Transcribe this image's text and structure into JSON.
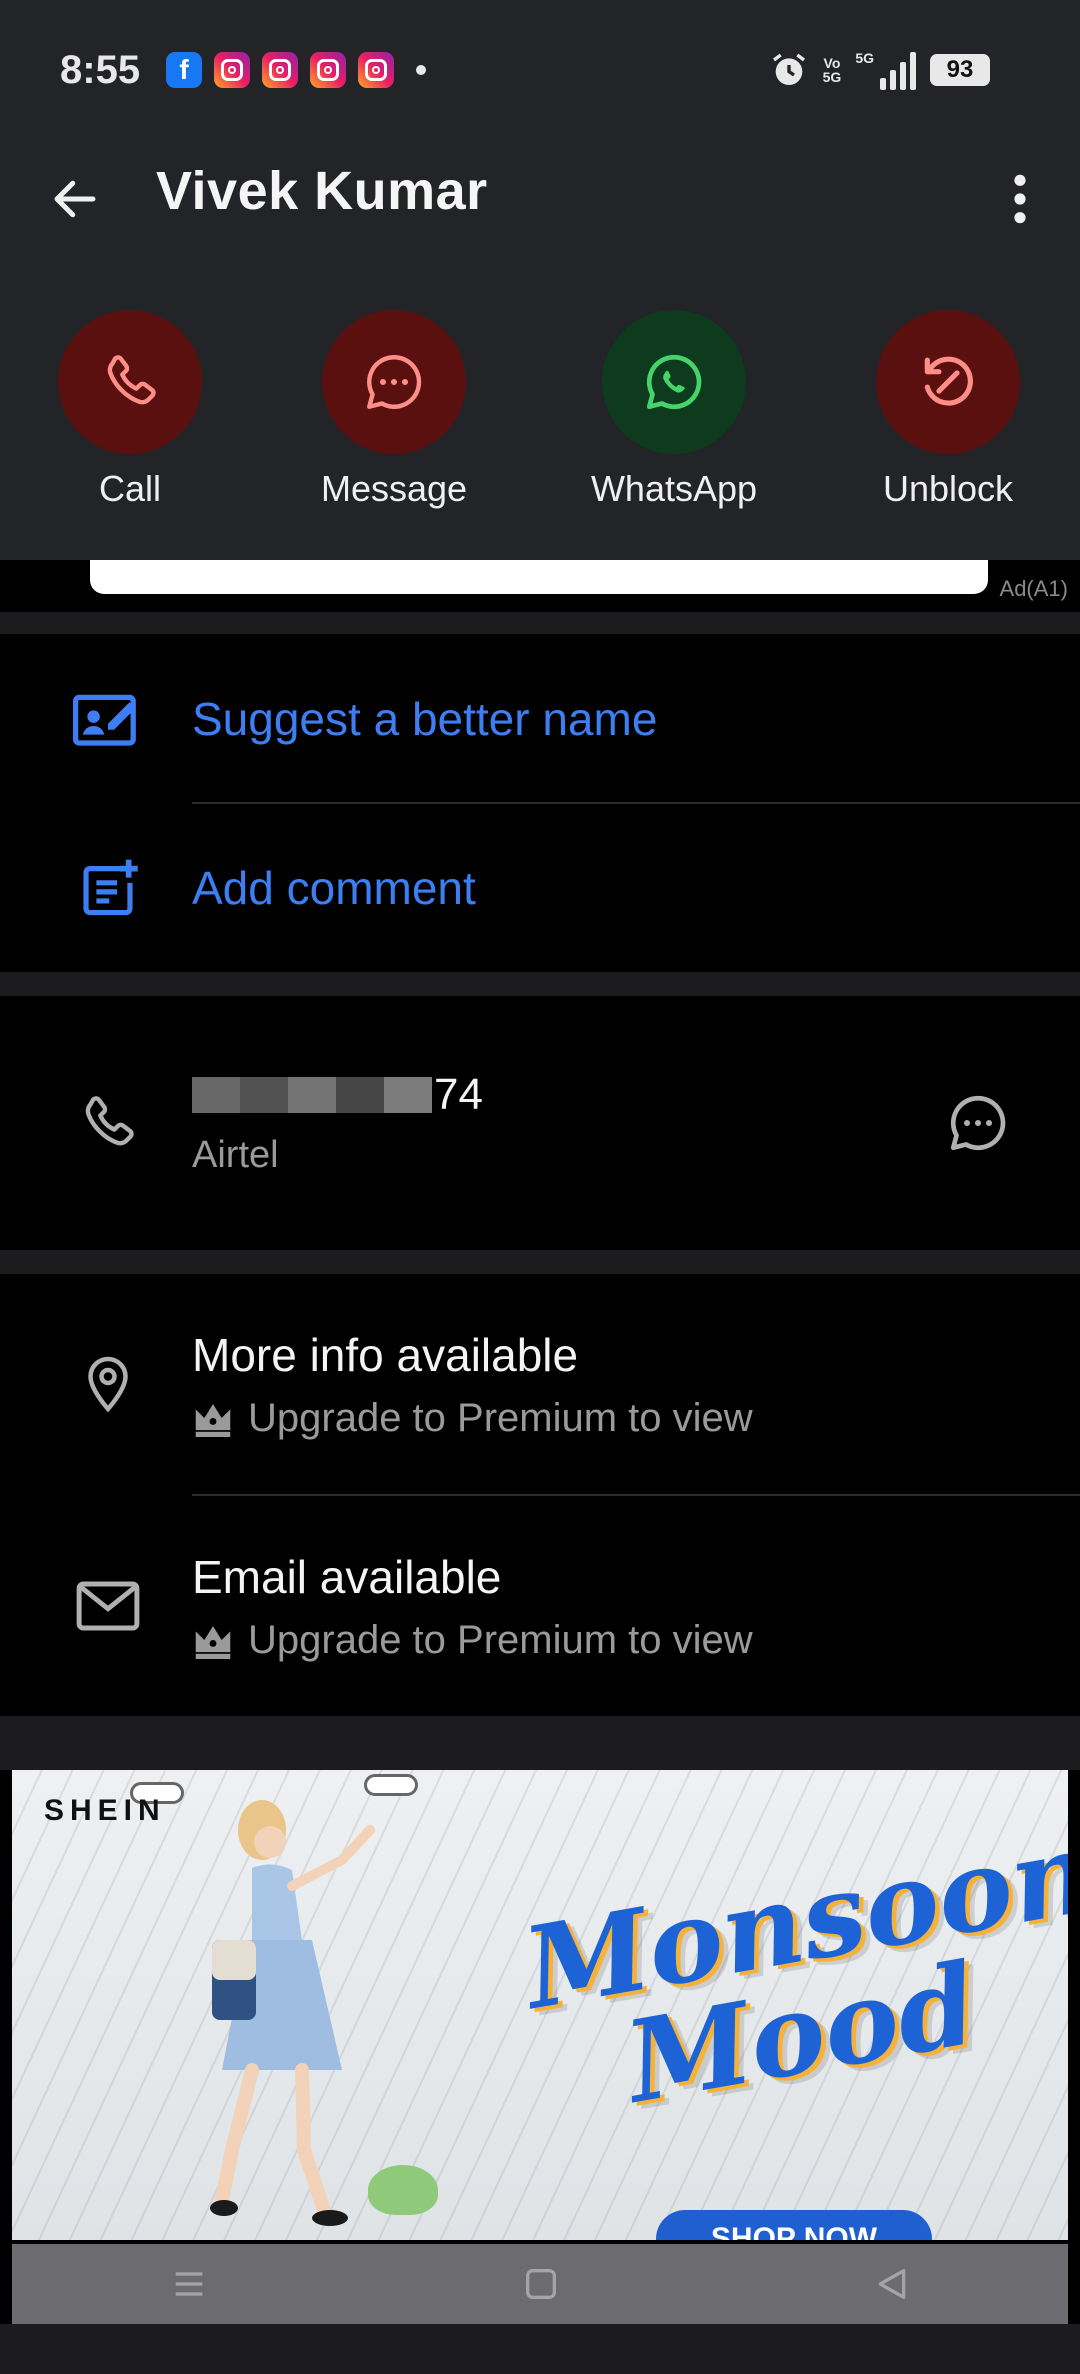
{
  "status_bar": {
    "time": "8:55",
    "notifications": [
      "facebook-icon",
      "instagram-icon",
      "instagram-icon",
      "instagram-icon",
      "instagram-icon"
    ],
    "volte_top": "Vo",
    "volte_bottom": "5G",
    "network": "5G",
    "battery": "93"
  },
  "header": {
    "title": "Vivek Kumar"
  },
  "actions": [
    {
      "label": "Call",
      "icon": "phone-icon",
      "color": "#5a100f"
    },
    {
      "label": "Message",
      "icon": "chat-icon",
      "color": "#5a100f"
    },
    {
      "label": "WhatsApp",
      "icon": "whatsapp-icon",
      "color": "#0e3a1d"
    },
    {
      "label": "Unblock",
      "icon": "unblock-icon",
      "color": "#5a100f"
    }
  ],
  "ad_strip": {
    "tag": "Ad(A1)"
  },
  "suggest": {
    "suggest_name": "Suggest a better name",
    "add_comment": "Add comment"
  },
  "phone": {
    "number_suffix": "74",
    "carrier": "Airtel"
  },
  "more_info": {
    "title": "More info available",
    "subtitle": "Upgrade to Premium to view"
  },
  "email": {
    "title": "Email available",
    "subtitle": "Upgrade to Premium to view"
  },
  "banner": {
    "brand": "SHEIN",
    "headline": "Monsoon Mood",
    "cta": "SHOP NOW"
  },
  "colors": {
    "accent_blue": "#3d7ef2",
    "header_bg": "#232428",
    "action_red": "#5a100f",
    "action_green": "#0e3a1d"
  }
}
